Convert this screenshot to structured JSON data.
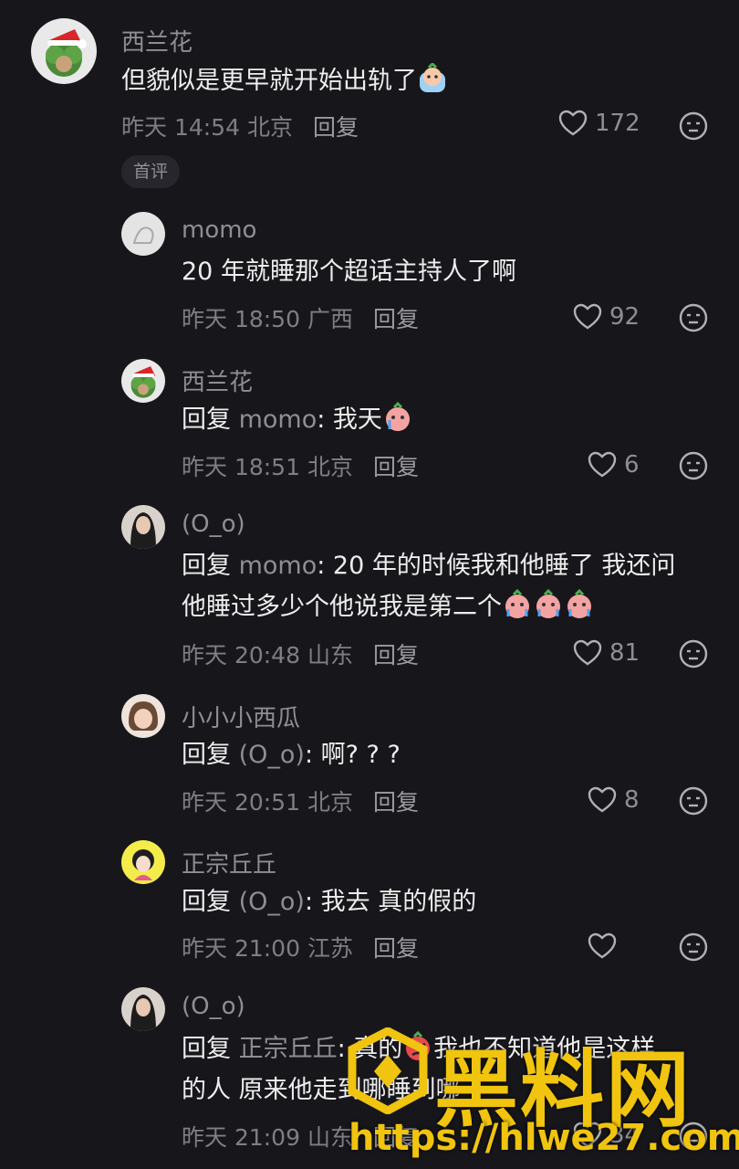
{
  "comments": [
    {
      "name": "西兰花",
      "text": "但貌似是更早就开始出轨了",
      "time": "昨天 14:54 北京",
      "reply": "回复",
      "likes": "172",
      "badge": "首评"
    },
    {
      "name": "momo",
      "text": "20 年就睡那个超话主持人了啊",
      "time": "昨天 18:50 广西",
      "reply": "回复",
      "likes": "92"
    },
    {
      "name": "西兰花",
      "prefix": "回复",
      "to": "momo",
      "text": ": 我天",
      "time": "昨天 18:51 北京",
      "reply": "回复",
      "likes": "6"
    },
    {
      "name": "(O_o)",
      "prefix": "回复",
      "to": "momo",
      "text": ": 20 年的时候我和他睡了 我还问",
      "text2": "他睡过多少个他说我是第二个",
      "time": "昨天 20:48 山东",
      "reply": "回复",
      "likes": "81"
    },
    {
      "name": "小小小西瓜",
      "prefix": "回复",
      "to": "(O_o)",
      "text": ": 啊? ? ?",
      "time": "昨天 20:51 北京",
      "reply": "回复",
      "likes": "8"
    },
    {
      "name": "正宗丘丘",
      "prefix": "回复",
      "to": "(O_o)",
      "text": ": 我去 真的假的",
      "time": "昨天 21:00 江苏",
      "reply": "回复",
      "likes": ""
    },
    {
      "name": "(O_o)",
      "prefix": "回复",
      "to": "正宗丘丘",
      "text": ": 真的",
      "text_b": "我也不知道他是这样",
      "text2": "的人 原来他走到哪睡到哪",
      "time": "昨天 21:09 山东",
      "reply": "回复",
      "likes": "34"
    }
  ],
  "watermark": {
    "title": "黑料网",
    "url": "https://hlwe27.com"
  },
  "colors": {
    "background": "#17171b",
    "accent_yellow": "#f0c40f"
  }
}
